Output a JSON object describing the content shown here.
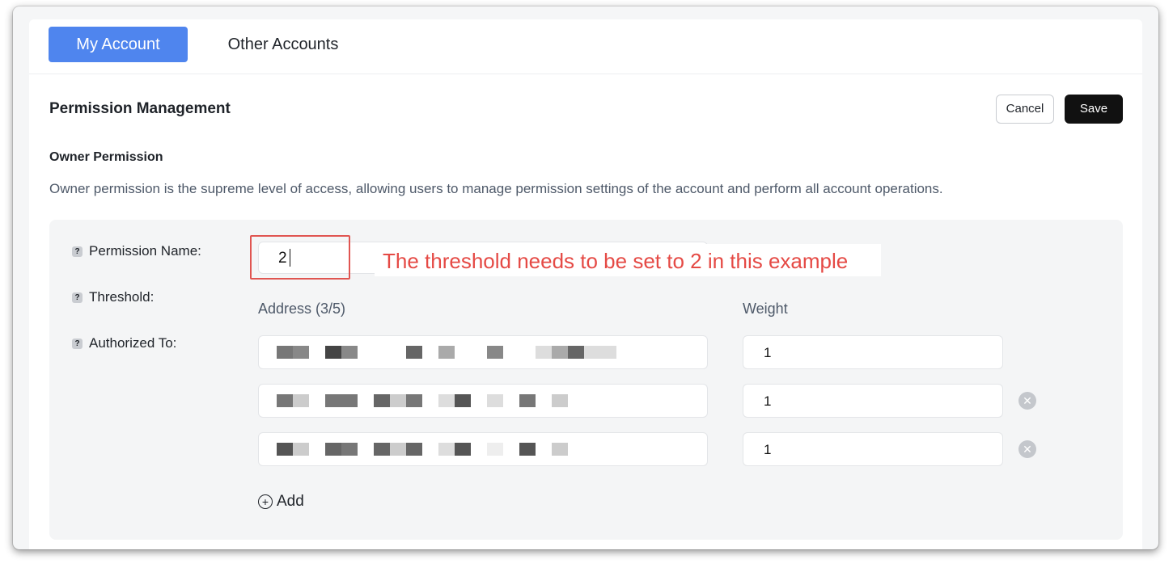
{
  "tabs": [
    {
      "label": "My Account",
      "active": true
    },
    {
      "label": "Other Accounts",
      "active": false
    }
  ],
  "header": {
    "title": "Permission Management",
    "cancel_label": "Cancel",
    "save_label": "Save"
  },
  "owner": {
    "title": "Owner Permission",
    "description": "Owner permission is the supreme level of access, allowing users to manage permission settings of the account and perform all account operations."
  },
  "form": {
    "permission_name_label": "Permission Name:",
    "threshold_label": "Threshold:",
    "authorized_label": "Authorized To:",
    "name_value": "2",
    "address_header": "Address (3/5)",
    "weight_header": "Weight",
    "rows": [
      {
        "weight": "1",
        "removable": false
      },
      {
        "weight": "1",
        "removable": true
      },
      {
        "weight": "1",
        "removable": true
      }
    ],
    "add_label": "Add"
  },
  "annotation": {
    "text": "The threshold needs to be set to 2 in this example",
    "color": "#e54a45"
  },
  "colors": {
    "accent": "#4f85ee",
    "save_button": "#111111"
  },
  "icons": [
    "help-icon",
    "remove-icon",
    "add-circle-icon"
  ]
}
